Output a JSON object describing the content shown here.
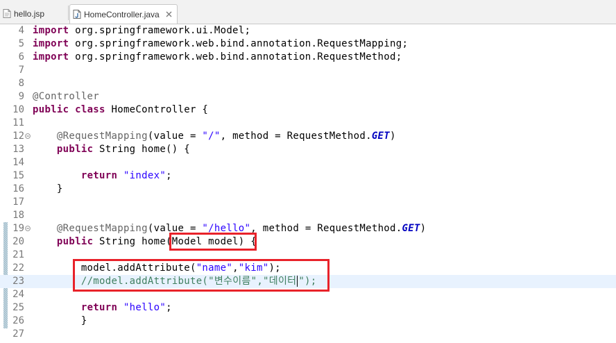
{
  "tabs": [
    {
      "label": "hello.jsp",
      "icon": "jsp-file-icon",
      "active": false
    },
    {
      "label": "HomeController.java",
      "icon": "java-file-icon",
      "active": true,
      "close_icon": "close-icon"
    }
  ],
  "editor": {
    "file": "HomeController.java",
    "colors": {
      "keyword": "#7f0055",
      "annotation": "#646464",
      "string": "#2a00ff",
      "constant": "#0000c0",
      "comment": "#3f7f5f",
      "current_line": "#e8f2fe",
      "highlight_box": "#e8222a"
    },
    "lines": [
      {
        "n": "4",
        "tokens": [
          {
            "t": "import",
            "c": "kw"
          },
          {
            "t": " org.springframework.ui.Model;"
          }
        ]
      },
      {
        "n": "5",
        "tokens": [
          {
            "t": "import",
            "c": "kw"
          },
          {
            "t": " org.springframework.web.bind.annotation.RequestMapping;"
          }
        ]
      },
      {
        "n": "6",
        "tokens": [
          {
            "t": "import",
            "c": "kw"
          },
          {
            "t": " org.springframework.web.bind.annotation.RequestMethod;"
          }
        ]
      },
      {
        "n": "7",
        "tokens": []
      },
      {
        "n": "8",
        "tokens": []
      },
      {
        "n": "9",
        "tokens": [
          {
            "t": "@Controller",
            "c": "ann"
          }
        ]
      },
      {
        "n": "10",
        "tokens": [
          {
            "t": "public",
            "c": "kw"
          },
          {
            "t": " "
          },
          {
            "t": "class",
            "c": "kw"
          },
          {
            "t": " HomeController {"
          }
        ]
      },
      {
        "n": "11",
        "tokens": []
      },
      {
        "n": "12",
        "fold": true,
        "tokens": [
          {
            "t": "    "
          },
          {
            "t": "@RequestMapping",
            "c": "ann"
          },
          {
            "t": "(value = "
          },
          {
            "t": "\"/\"",
            "c": "str"
          },
          {
            "t": ", method = RequestMethod."
          },
          {
            "t": "GET",
            "c": "cst"
          },
          {
            "t": ")"
          }
        ]
      },
      {
        "n": "13",
        "tokens": [
          {
            "t": "    "
          },
          {
            "t": "public",
            "c": "kw"
          },
          {
            "t": " String home() {"
          }
        ]
      },
      {
        "n": "14",
        "tokens": []
      },
      {
        "n": "15",
        "tokens": [
          {
            "t": "        "
          },
          {
            "t": "return",
            "c": "kw"
          },
          {
            "t": " "
          },
          {
            "t": "\"index\"",
            "c": "str"
          },
          {
            "t": ";"
          }
        ]
      },
      {
        "n": "16",
        "tokens": [
          {
            "t": "    }"
          }
        ]
      },
      {
        "n": "17",
        "tokens": []
      },
      {
        "n": "18",
        "tokens": []
      },
      {
        "n": "19",
        "fold": true,
        "tokens": [
          {
            "t": "    "
          },
          {
            "t": "@RequestMapping",
            "c": "ann"
          },
          {
            "t": "(value = "
          },
          {
            "t": "\"/hello\"",
            "c": "str"
          },
          {
            "t": ", method = RequestMethod."
          },
          {
            "t": "GET",
            "c": "cst"
          },
          {
            "t": ")"
          }
        ]
      },
      {
        "n": "20",
        "tokens": [
          {
            "t": "    "
          },
          {
            "t": "public",
            "c": "kw"
          },
          {
            "t": " String home(Model model) {"
          }
        ]
      },
      {
        "n": "21",
        "tokens": []
      },
      {
        "n": "22",
        "tokens": [
          {
            "t": "        model.addAttribute("
          },
          {
            "t": "\"name\"",
            "c": "str"
          },
          {
            "t": ","
          },
          {
            "t": "\"kim\"",
            "c": "str"
          },
          {
            "t": ");"
          }
        ]
      },
      {
        "n": "23",
        "current": true,
        "tokens": [
          {
            "t": "        "
          },
          {
            "t": "//model.addAttribute(\"변수이름\",\"데이터",
            "c": "cmt"
          },
          {
            "caret": true
          },
          {
            "t": "\");",
            "c": "cmt"
          }
        ]
      },
      {
        "n": "24",
        "tokens": []
      },
      {
        "n": "25",
        "tokens": [
          {
            "t": "        "
          },
          {
            "t": "return",
            "c": "kw"
          },
          {
            "t": " "
          },
          {
            "t": "\"hello\"",
            "c": "str"
          },
          {
            "t": ";"
          }
        ]
      },
      {
        "n": "26",
        "tokens": [
          {
            "t": "        }"
          }
        ]
      },
      {
        "n": "27",
        "tokens": []
      }
    ]
  }
}
